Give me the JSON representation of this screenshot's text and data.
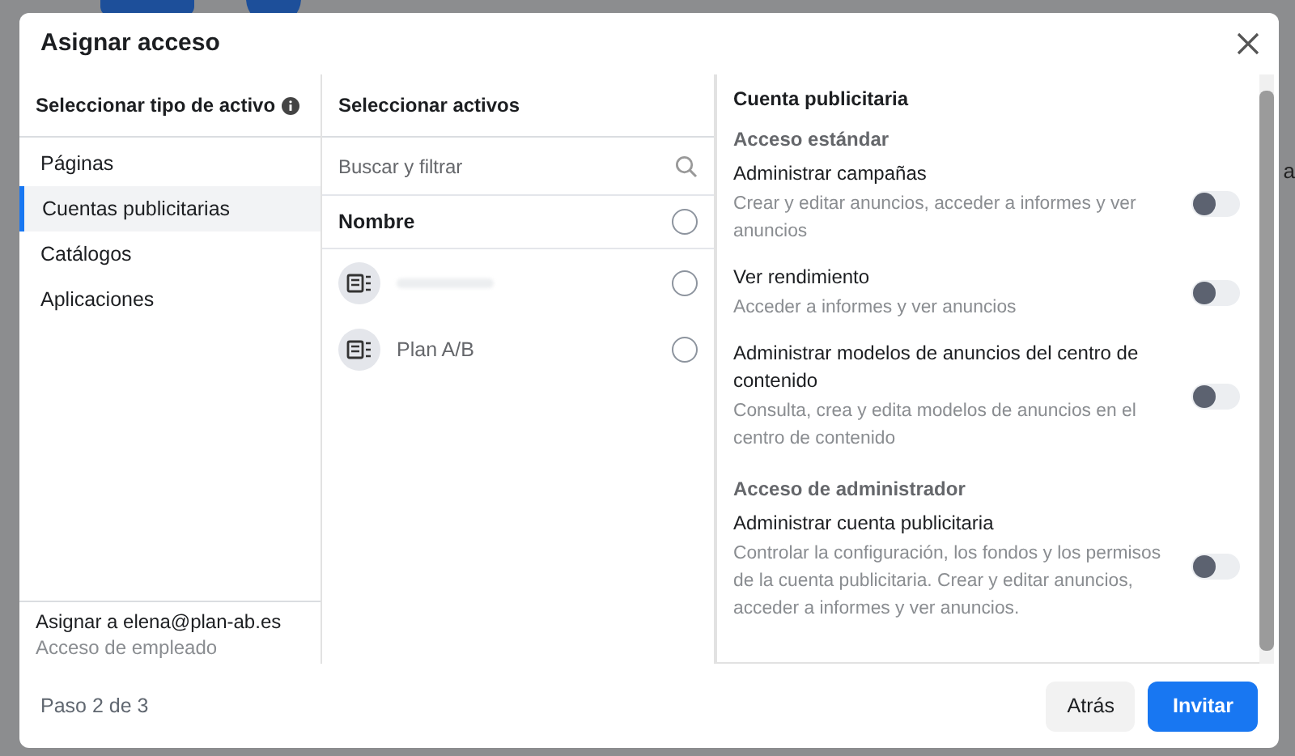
{
  "backdrop": {
    "column_3": "a"
  },
  "dialog": {
    "title": "Asignar acceso",
    "asset_types": {
      "heading": "Seleccionar tipo de activo",
      "items": [
        {
          "label": "Páginas",
          "selected": false
        },
        {
          "label": "Cuentas publicitarias",
          "selected": true
        },
        {
          "label": "Catálogos",
          "selected": false
        },
        {
          "label": "Aplicaciones",
          "selected": false
        }
      ],
      "assign_to": "Asignar a elena@plan-ab.es",
      "access_type": "Acceso de empleado"
    },
    "assets": {
      "heading": "Seleccionar activos",
      "search": {
        "placeholder": "Buscar y filtrar"
      },
      "column_header": "Nombre",
      "select_all_checked": false,
      "rows": [
        {
          "redacted": true,
          "checked": false
        },
        {
          "name": "Plan A/B",
          "redacted": false,
          "checked": false
        }
      ]
    },
    "permissions": {
      "heading": "Cuenta publicitaria",
      "sections": [
        {
          "title": "Acceso estándar",
          "items": [
            {
              "name": "Administrar campañas",
              "description": "Crear y editar anuncios, acceder a informes y ver anuncios",
              "on": false
            },
            {
              "name": "Ver rendimiento",
              "description": "Acceder a informes y ver anuncios",
              "on": false
            },
            {
              "name": "Administrar modelos de anuncios del centro de contenido",
              "description": "Consulta, crea y edita modelos de anuncios en el centro de contenido",
              "on": false
            }
          ]
        },
        {
          "title": "Acceso de administrador",
          "items": [
            {
              "name": "Administrar cuenta publicitaria",
              "description": "Controlar la configuración, los fondos y los permisos de la cuenta publicitaria. Crear y editar anuncios, acceder a informes y ver anuncios.",
              "on": false
            }
          ]
        }
      ]
    },
    "step": "Paso 2 de 3",
    "buttons": {
      "back": "Atrás",
      "primary": "Invitar"
    }
  }
}
